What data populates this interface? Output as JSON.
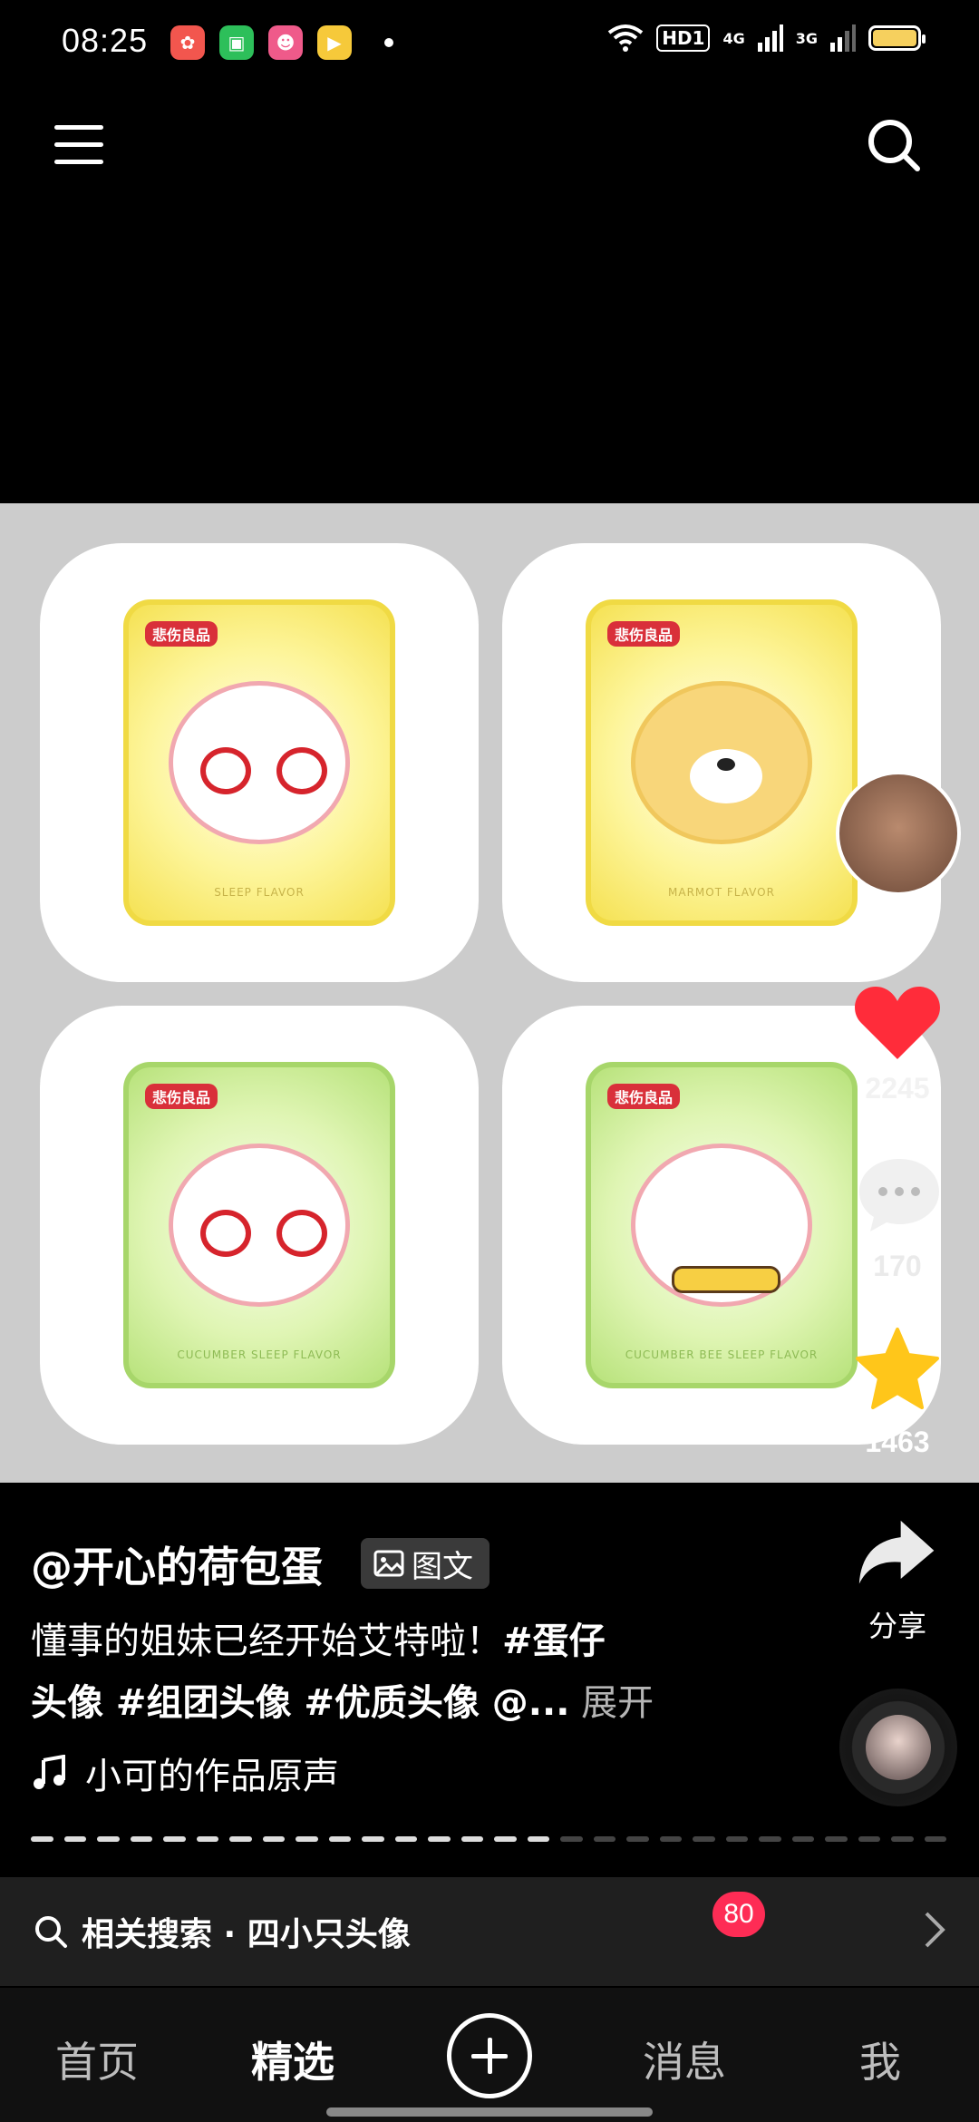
{
  "status_bar": {
    "time": "08:25",
    "hd": "HD1",
    "net1": "4G",
    "net2": "3G",
    "battery_color": "#f6d05e"
  },
  "top_nav": {
    "menu_icon": "menu-icon",
    "search_icon": "search-icon"
  },
  "media": {
    "tiles": [
      {
        "brand": "悲伤良品",
        "flavor": "SLEEP FLAVOR",
        "color": "yellow"
      },
      {
        "brand": "悲伤良品",
        "flavor": "MARMOT FLAVOR",
        "color": "yellow"
      },
      {
        "brand": "悲伤良品",
        "flavor": "CUCUMBER SLEEP FLAVOR",
        "color": "green"
      },
      {
        "brand": "悲伤良品",
        "flavor": "CUCUMBER BEE SLEEP FLAVOR",
        "color": "green"
      }
    ]
  },
  "rail": {
    "like_count": "2245",
    "comment_count": "170",
    "favorite_count": "1463",
    "share_label": "分享",
    "like_color": "#ff2c3a",
    "favorite_color": "#ffc61a"
  },
  "post": {
    "author": "@开心的荷包蛋",
    "type_tag": "图文",
    "caption_text": "懂事的姐妹已经开始艾特啦！",
    "caption_tags_line1": "#蛋仔",
    "caption_tags_line2": "头像 #组团头像 #优质头像 @...",
    "expand_label": "展开",
    "music": "小可的作品原声"
  },
  "related_search": {
    "label": "相关搜索 · 四小只头像"
  },
  "bottom_nav": {
    "home": "首页",
    "featured": "精选",
    "messages": "消息",
    "me": "我",
    "messages_badge": "80",
    "badge_color": "#fe2c55"
  }
}
